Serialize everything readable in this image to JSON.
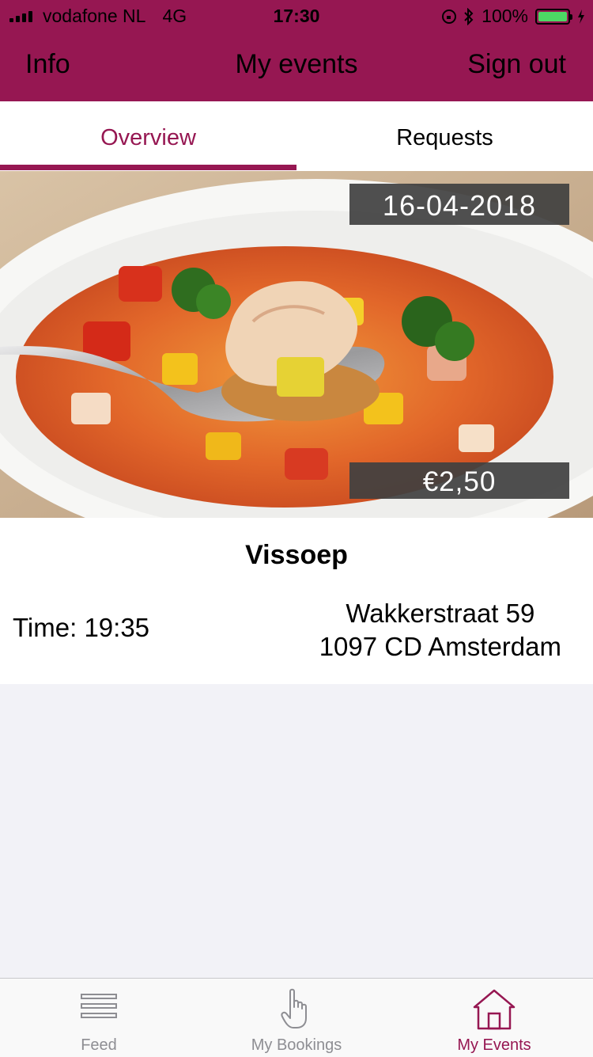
{
  "status_bar": {
    "carrier": "vodafone NL",
    "network": "4G",
    "time": "17:30",
    "battery": "100%"
  },
  "nav": {
    "info": "Info",
    "title": "My events",
    "sign_out": "Sign out"
  },
  "tabs": {
    "overview": "Overview",
    "requests": "Requests",
    "selected": "Overview"
  },
  "event": {
    "date": "16-04-2018",
    "price": "€2,50",
    "name": "Vissoep",
    "time": "Time: 19:35",
    "address_line1": "Wakkerstraat 59",
    "address_line2": "1097 CD Amsterdam"
  },
  "tab_bar": {
    "feed": "Feed",
    "bookings": "My Bookings",
    "events": "My Events",
    "selected": "My Events"
  },
  "colors": {
    "brand": "#961752",
    "badge_bg": "#404040",
    "inactive": "#8e8e93",
    "battery": "#4cd964"
  },
  "icons": {
    "feed": "list-lines-icon",
    "bookings": "pointing-hand-icon",
    "events": "house-icon"
  }
}
